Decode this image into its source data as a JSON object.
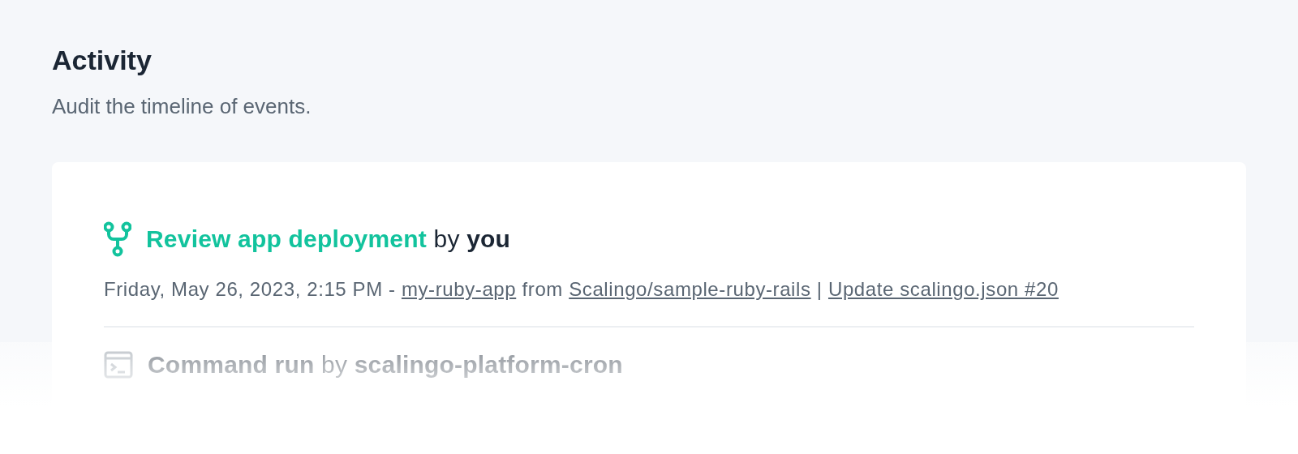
{
  "page": {
    "title": "Activity",
    "subtitle": "Audit the timeline of events."
  },
  "events": [
    {
      "kind": "deployment",
      "action": "Review app deployment",
      "by": "by",
      "actor": "you",
      "meta": [
        {
          "kind": "text",
          "text": "Friday, May 26, 2023, 2:15 PM -"
        },
        {
          "kind": "link",
          "text": "my-ruby-app"
        },
        {
          "kind": "text",
          "text": "from"
        },
        {
          "kind": "link",
          "text": "Scalingo/sample-ruby-rails"
        },
        {
          "kind": "text",
          "text": "|"
        },
        {
          "kind": "link",
          "text": "Update scalingo.json #20"
        }
      ]
    },
    {
      "kind": "command",
      "action": "Command run",
      "by": "by",
      "actor": "scalingo-platform-cron"
    }
  ]
}
